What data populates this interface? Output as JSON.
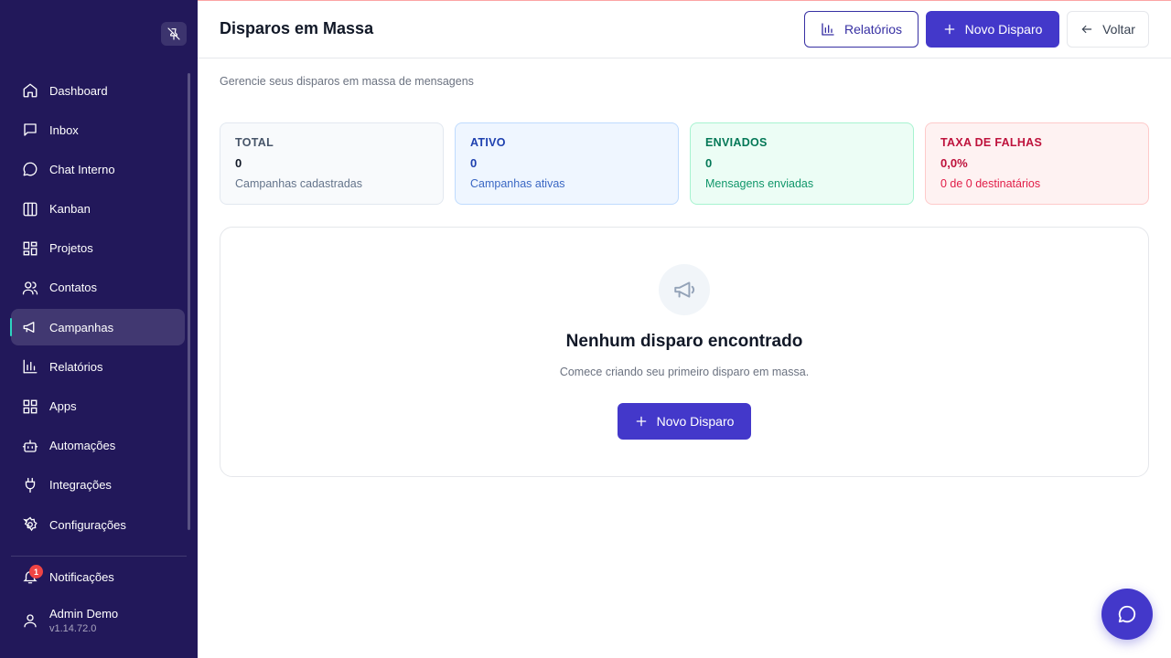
{
  "sidebar": {
    "items": [
      {
        "label": "Dashboard",
        "icon": "home-icon"
      },
      {
        "label": "Inbox",
        "icon": "inbox-icon"
      },
      {
        "label": "Chat Interno",
        "icon": "chat-icon"
      },
      {
        "label": "Kanban",
        "icon": "kanban-icon"
      },
      {
        "label": "Projetos",
        "icon": "projects-icon"
      },
      {
        "label": "Contatos",
        "icon": "contacts-icon"
      },
      {
        "label": "Campanhas",
        "icon": "megaphone-icon",
        "active": true
      },
      {
        "label": "Relatórios",
        "icon": "bar-chart-icon"
      },
      {
        "label": "Apps",
        "icon": "apps-icon"
      },
      {
        "label": "Automações",
        "icon": "bot-icon"
      },
      {
        "label": "Integrações",
        "icon": "plug-icon"
      },
      {
        "label": "Configurações",
        "icon": "gear-icon"
      }
    ],
    "notifications": {
      "label": "Notificações",
      "count": "1"
    },
    "user": {
      "name": "Admin Demo",
      "version": "v1.14.72.0"
    }
  },
  "header": {
    "title": "Disparos em Massa",
    "reports_label": "Relatórios",
    "new_label": "Novo Disparo",
    "back_label": "Voltar"
  },
  "subtitle": "Gerencie seus disparos em massa de mensagens",
  "stats": {
    "total": {
      "label": "TOTAL",
      "value": "0",
      "desc": "Campanhas cadastradas"
    },
    "active": {
      "label": "ATIVO",
      "value": "0",
      "desc": "Campanhas ativas"
    },
    "sent": {
      "label": "ENVIADOS",
      "value": "0",
      "desc": "Mensagens enviadas"
    },
    "failures": {
      "label": "TAXA DE FALHAS",
      "value": "0,0%",
      "desc": "0 de 0 destinatários"
    }
  },
  "empty": {
    "title": "Nenhum disparo encontrado",
    "desc": "Comece criando seu primeiro disparo em massa.",
    "button_label": "Novo Disparo"
  },
  "colors": {
    "sidebar_bg": "#22185a",
    "primary": "#4338ca",
    "active_accent": "#2dd4bf"
  }
}
